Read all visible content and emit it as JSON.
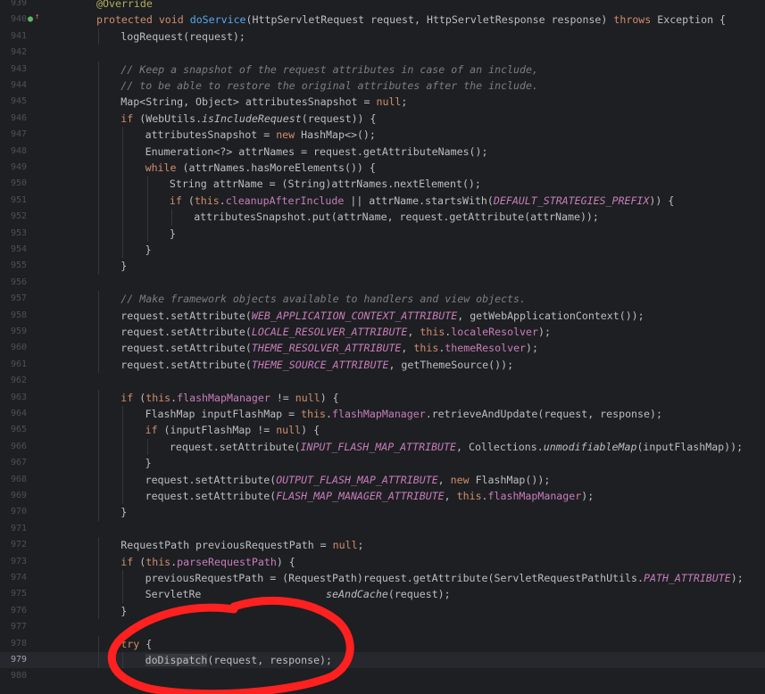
{
  "editor": {
    "line_numbers": [
      "939",
      "940",
      "941",
      "942",
      "943",
      "944",
      "945",
      "946",
      "947",
      "948",
      "949",
      "950",
      "951",
      "952",
      "953",
      "954",
      "955",
      "956",
      "957",
      "958",
      "959",
      "960",
      "961",
      "962",
      "963",
      "964",
      "965",
      "966",
      "967",
      "968",
      "969",
      "970",
      "971",
      "972",
      "973",
      "974",
      "975",
      "976",
      "977",
      "978",
      "979",
      "980"
    ],
    "current_line": "979",
    "gutter_icon_line": "940",
    "lines": [
      [
        [
          "@Override",
          "an"
        ]
      ],
      [
        [
          "protected",
          "kw"
        ],
        [
          " ",
          "pl"
        ],
        [
          "void",
          "kw"
        ],
        [
          " ",
          "pl"
        ],
        [
          "doService",
          "fn"
        ],
        [
          "(HttpServletRequest request, HttpServletResponse response) ",
          "tx"
        ],
        [
          "throws",
          "kw"
        ],
        [
          " Exception {",
          "tx"
        ]
      ],
      [
        [
          "logRequest(request);",
          "tx"
        ]
      ],
      [],
      [
        [
          "// Keep a snapshot of the request attributes in case of an include,",
          "cm"
        ]
      ],
      [
        [
          "// to be able to restore the original attributes after the include.",
          "cm"
        ]
      ],
      [
        [
          "Map<String, Object> attributesSnapshot = ",
          "tx"
        ],
        [
          "null",
          "kw"
        ],
        [
          ";",
          "tx"
        ]
      ],
      [
        [
          "if",
          "kw"
        ],
        [
          " (WebUtils.",
          "tx"
        ],
        [
          "isIncludeRequest",
          "st"
        ],
        [
          "(request)) {",
          "tx"
        ]
      ],
      [
        [
          "attributesSnapshot = ",
          "tx"
        ],
        [
          "new",
          "kw"
        ],
        [
          " HashMap<>();",
          "tx"
        ]
      ],
      [
        [
          "Enumeration<?> attrNames = request.getAttributeNames();",
          "tx"
        ]
      ],
      [
        [
          "while",
          "kw"
        ],
        [
          " (attrNames.hasMoreElements()) {",
          "tx"
        ]
      ],
      [
        [
          "String attrName = (String)attrNames.nextElement();",
          "tx"
        ]
      ],
      [
        [
          "if",
          "kw"
        ],
        [
          " (",
          "tx"
        ],
        [
          "this",
          "kw"
        ],
        [
          ".",
          "tx"
        ],
        [
          "cleanupAfterInclude",
          "fd"
        ],
        [
          " || attrName.startsWith(",
          "tx"
        ],
        [
          "DEFAULT_STRATEGIES_PREFIX",
          "cs"
        ],
        [
          ")) {",
          "tx"
        ]
      ],
      [
        [
          "attributesSnapshot.put(attrName, request.getAttribute(attrName));",
          "tx"
        ]
      ],
      [
        [
          "}",
          "tx"
        ]
      ],
      [
        [
          "}",
          "tx"
        ]
      ],
      [
        [
          "}",
          "tx"
        ]
      ],
      [],
      [
        [
          "// Make framework objects available to handlers and view objects.",
          "cm"
        ]
      ],
      [
        [
          "request.setAttribute(",
          "tx"
        ],
        [
          "WEB_APPLICATION_CONTEXT_ATTRIBUTE",
          "cs"
        ],
        [
          ", getWebApplicationContext());",
          "tx"
        ]
      ],
      [
        [
          "request.setAttribute(",
          "tx"
        ],
        [
          "LOCALE_RESOLVER_ATTRIBUTE",
          "cs"
        ],
        [
          ", ",
          "tx"
        ],
        [
          "this",
          "kw"
        ],
        [
          ".",
          "tx"
        ],
        [
          "localeResolver",
          "fd"
        ],
        [
          ");",
          "tx"
        ]
      ],
      [
        [
          "request.setAttribute(",
          "tx"
        ],
        [
          "THEME_RESOLVER_ATTRIBUTE",
          "cs"
        ],
        [
          ", ",
          "tx"
        ],
        [
          "this",
          "kw"
        ],
        [
          ".",
          "tx"
        ],
        [
          "themeResolver",
          "fd"
        ],
        [
          ");",
          "tx"
        ]
      ],
      [
        [
          "request.setAttribute(",
          "tx"
        ],
        [
          "THEME_SOURCE_ATTRIBUTE",
          "cs"
        ],
        [
          ", getThemeSource());",
          "tx"
        ]
      ],
      [],
      [
        [
          "if",
          "kw"
        ],
        [
          " (",
          "tx"
        ],
        [
          "this",
          "kw"
        ],
        [
          ".",
          "tx"
        ],
        [
          "flashMapManager",
          "fd"
        ],
        [
          " != ",
          "tx"
        ],
        [
          "null",
          "kw"
        ],
        [
          ") {",
          "tx"
        ]
      ],
      [
        [
          "FlashMap inputFlashMap = ",
          "tx"
        ],
        [
          "this",
          "kw"
        ],
        [
          ".",
          "tx"
        ],
        [
          "flashMapManager",
          "fd"
        ],
        [
          ".retrieveAndUpdate(request, response);",
          "tx"
        ]
      ],
      [
        [
          "if",
          "kw"
        ],
        [
          " (inputFlashMap != ",
          "tx"
        ],
        [
          "null",
          "kw"
        ],
        [
          ") {",
          "tx"
        ]
      ],
      [
        [
          "request.setAttribute(",
          "tx"
        ],
        [
          "INPUT_FLASH_MAP_ATTRIBUTE",
          "cs"
        ],
        [
          ", Collections.",
          "tx"
        ],
        [
          "unmodifiableMap",
          "st"
        ],
        [
          "(inputFlashMap));",
          "tx"
        ]
      ],
      [
        [
          "}",
          "tx"
        ]
      ],
      [
        [
          "request.setAttribute(",
          "tx"
        ],
        [
          "OUTPUT_FLASH_MAP_ATTRIBUTE",
          "cs"
        ],
        [
          ", ",
          "tx"
        ],
        [
          "new",
          "kw"
        ],
        [
          " FlashMap());",
          "tx"
        ]
      ],
      [
        [
          "request.setAttribute(",
          "tx"
        ],
        [
          "FLASH_MAP_MANAGER_ATTRIBUTE",
          "cs"
        ],
        [
          ", ",
          "tx"
        ],
        [
          "this",
          "kw"
        ],
        [
          ".",
          "tx"
        ],
        [
          "flashMapManager",
          "fd"
        ],
        [
          ");",
          "tx"
        ]
      ],
      [
        [
          "}",
          "tx"
        ]
      ],
      [],
      [
        [
          "RequestPath previousRequestPath = ",
          "tx"
        ],
        [
          "null",
          "kw"
        ],
        [
          ";",
          "tx"
        ]
      ],
      [
        [
          "if",
          "kw"
        ],
        [
          " (",
          "tx"
        ],
        [
          "this",
          "kw"
        ],
        [
          ".",
          "tx"
        ],
        [
          "parseRequestPath",
          "fd"
        ],
        [
          ") {",
          "tx"
        ]
      ],
      [
        [
          "previousRequestPath = (RequestPath)request.getAttribute(ServletRequestPathUtils.",
          "tx"
        ],
        [
          "PATH_ATTRIBUTE",
          "cs"
        ],
        [
          ");",
          "tx"
        ]
      ],
      [
        [
          "ServletRe",
          "tx"
        ],
        [
          "                    ",
          "pl"
        ],
        [
          "seAndCache",
          "st"
        ],
        [
          "(request);",
          "tx"
        ]
      ],
      [
        [
          "}",
          "tx"
        ]
      ],
      [],
      [
        [
          "try",
          "kw"
        ],
        [
          " {",
          "tx"
        ]
      ],
      [
        [
          "doDispatch",
          "hl"
        ],
        [
          "(request, response);",
          "tx"
        ]
      ],
      []
    ]
  },
  "colors": {
    "background": "#1e1f22",
    "current_line": "#26282e",
    "keyword": "#cf8e6d",
    "method": "#56a8f5",
    "comment": "#7a7e85",
    "annotation": "#b3ae60",
    "field": "#c77dbb",
    "text": "#bcbec4",
    "annotation_marker": "#ff2020"
  },
  "icons": {
    "gutter": "override-marker-icon"
  }
}
